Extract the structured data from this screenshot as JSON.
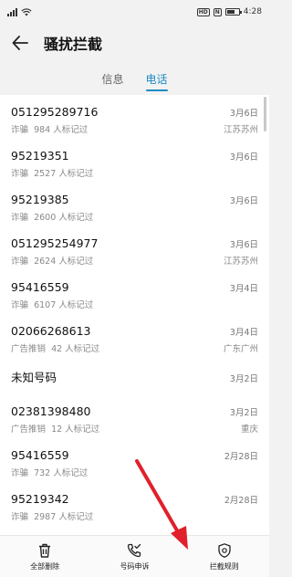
{
  "status_bar": {
    "time": "4:28",
    "hd_badge": "HD",
    "mute_badge": "N"
  },
  "header": {
    "title": "骚扰拦截"
  },
  "tabs": [
    {
      "label": "信息",
      "active": false
    },
    {
      "label": "电话",
      "active": true
    }
  ],
  "calls": [
    {
      "number": "051295289716",
      "date": "3月6日",
      "tag": "诈骗",
      "reports": "984 人标记过",
      "location": "江苏苏州"
    },
    {
      "number": "95219351",
      "date": "3月6日",
      "tag": "诈骗",
      "reports": "2527 人标记过",
      "location": ""
    },
    {
      "number": "95219385",
      "date": "3月6日",
      "tag": "诈骗",
      "reports": "2600 人标记过",
      "location": ""
    },
    {
      "number": "051295254977",
      "date": "3月6日",
      "tag": "诈骗",
      "reports": "2624 人标记过",
      "location": "江苏苏州"
    },
    {
      "number": "95416559",
      "date": "3月4日",
      "tag": "诈骗",
      "reports": "6107 人标记过",
      "location": ""
    },
    {
      "number": "02066268613",
      "date": "3月4日",
      "tag": "广告推销",
      "reports": "42 人标记过",
      "location": "广东广州"
    },
    {
      "number": "未知号码",
      "date": "3月2日",
      "tag": "",
      "reports": "",
      "location": ""
    },
    {
      "number": "02381398480",
      "date": "3月2日",
      "tag": "广告推销",
      "reports": "12 人标记过",
      "location": "重庆"
    },
    {
      "number": "95416559",
      "date": "2月28日",
      "tag": "诈骗",
      "reports": "732 人标记过",
      "location": ""
    },
    {
      "number": "95219342",
      "date": "2月28日",
      "tag": "诈骗",
      "reports": "2987 人标记过",
      "location": ""
    }
  ],
  "bottom_bar": {
    "delete_all": "全部删除",
    "report_number": "号码申诉",
    "block_rules": "拦截规则"
  },
  "colors": {
    "accent": "#1f8ac6",
    "annotation": "#e0202a"
  }
}
